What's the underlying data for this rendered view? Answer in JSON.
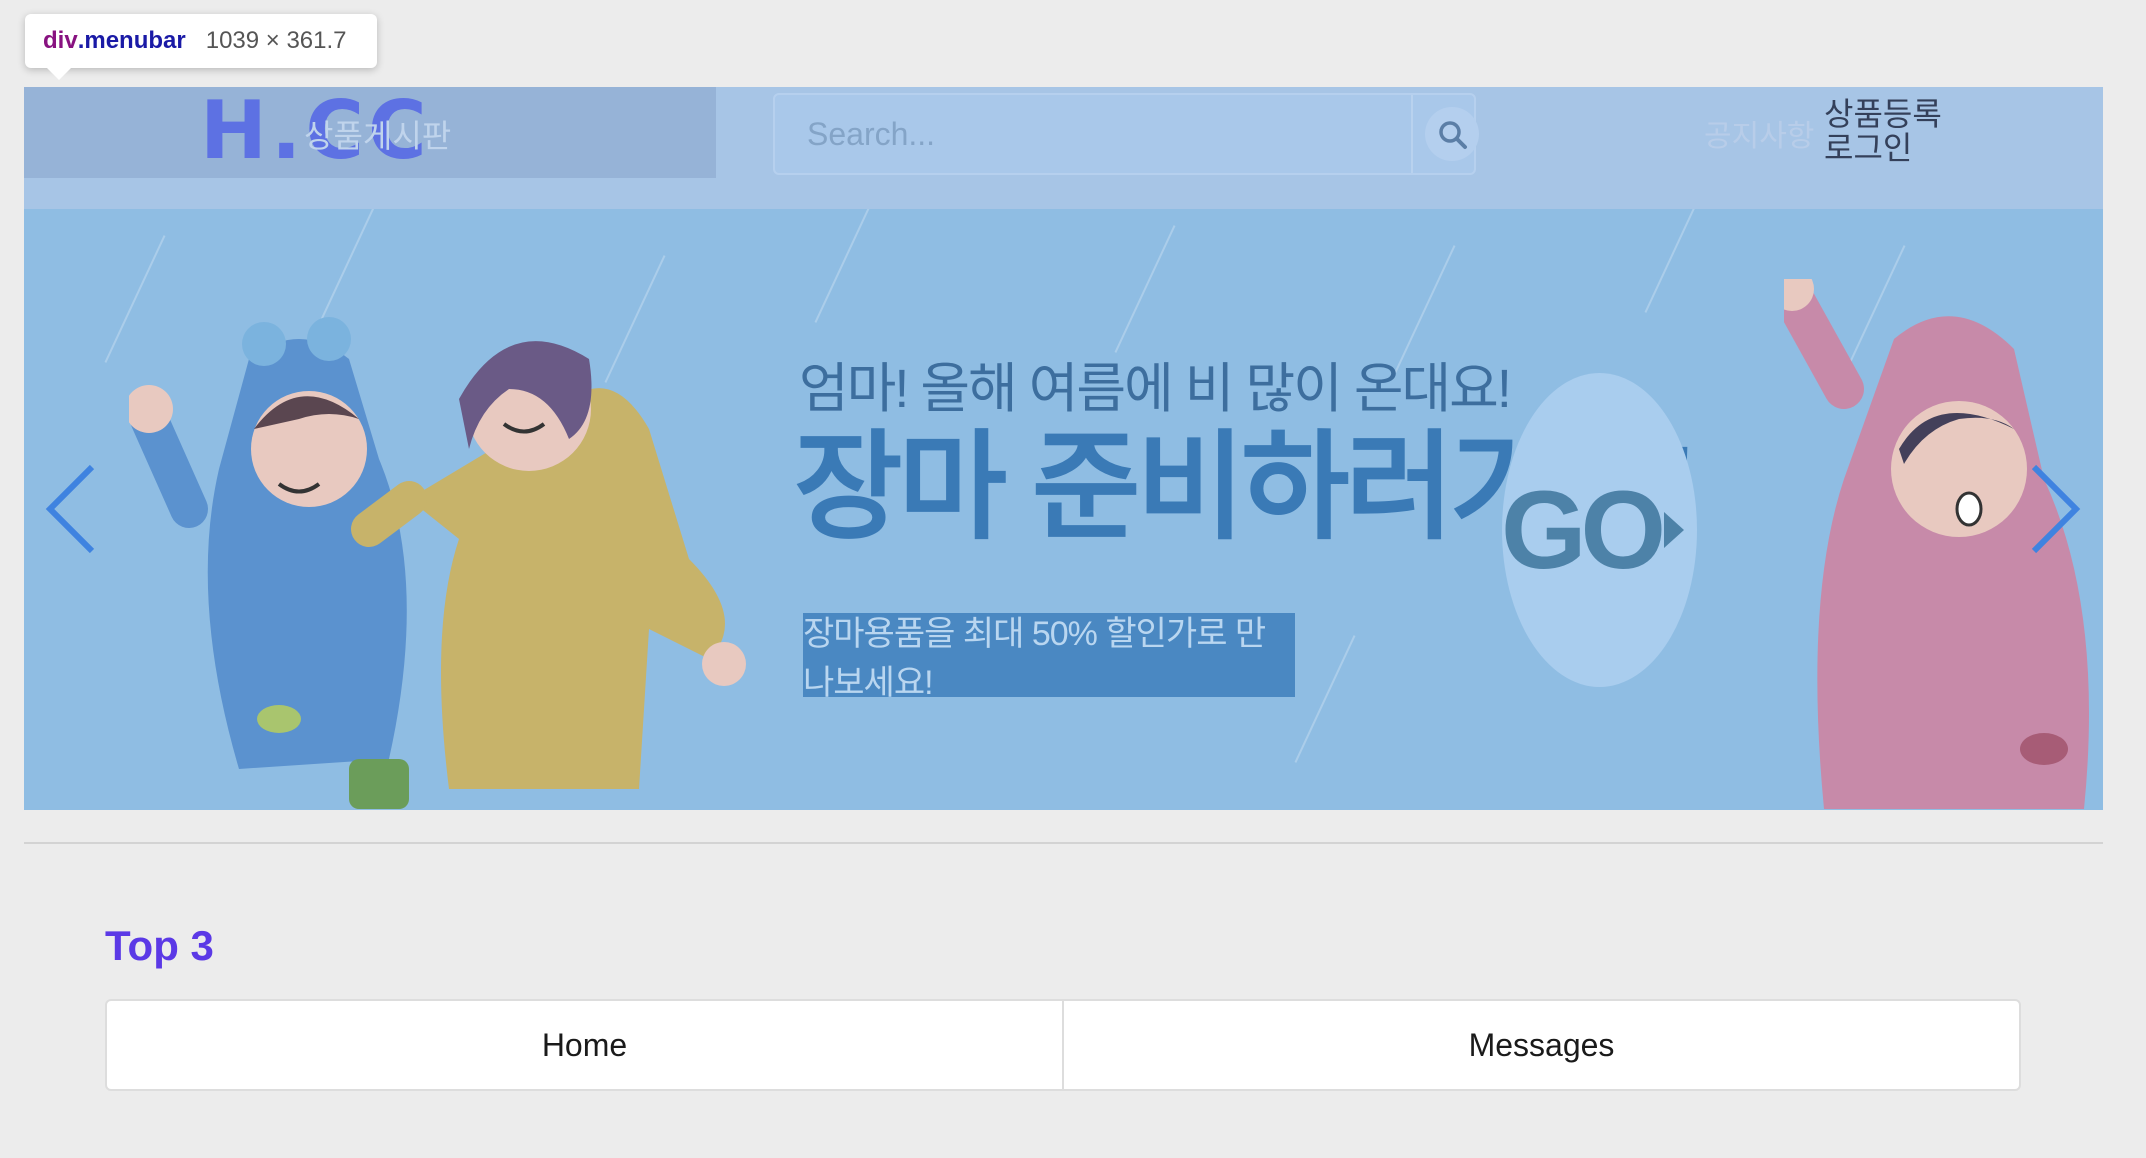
{
  "devtools": {
    "tag": "div",
    "class_name": ".menubar",
    "dims": "1039 × 361.7"
  },
  "header": {
    "logo": "H.CC",
    "board_link": "상품게시판",
    "search_placeholder": "Search...",
    "search_icon": "search-icon",
    "notice_link": "공지사항",
    "register_link": "상품등록",
    "login_link": "로그인"
  },
  "banner": {
    "subtitle": "엄마! 올해 여름에 비 많이 온대요!",
    "title": "장마 준비하러가요!",
    "tag": "장마용품을 최대 50% 할인가로 만나보세요!",
    "go_label": "GO",
    "prev_icon": "chevron-left-icon",
    "next_icon": "chevron-right-icon"
  },
  "top3": {
    "title": "Top 3",
    "tabs": [
      "Home",
      "Messages"
    ]
  },
  "colors": {
    "accent": "#5b39e6",
    "banner_bg": "#8fbde3",
    "menubar_bg": "#a7c5e6"
  }
}
